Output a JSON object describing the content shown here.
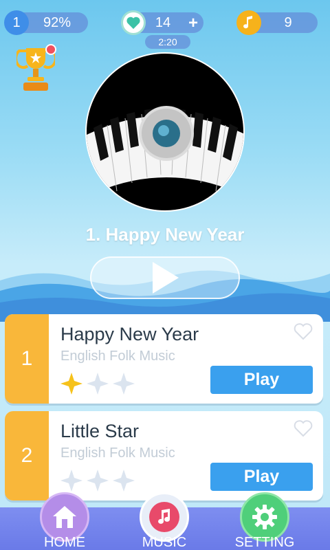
{
  "status": {
    "level": "1",
    "progress": "92%",
    "lives": "14",
    "lives_timer": "2:20",
    "notes": "9"
  },
  "now_playing": {
    "title": "1. Happy New Year"
  },
  "songs": [
    {
      "index": "1",
      "name": "Happy New Year",
      "artist": "English Folk Music",
      "stars_earned": 1,
      "stars_total": 3,
      "play_label": "Play"
    },
    {
      "index": "2",
      "name": "Little Star",
      "artist": "English Folk Music",
      "stars_earned": 0,
      "stars_total": 3,
      "play_label": "Play"
    }
  ],
  "nav": {
    "home": "HOME",
    "music": "MUSIC",
    "setting": "SETTING"
  },
  "icons": {
    "level": "level-badge-icon",
    "lives": "heart-icon",
    "notes": "music-note-icon",
    "trophy": "trophy-icon",
    "play": "play-icon",
    "home": "home-icon",
    "music": "music-icon",
    "setting": "gear-icon"
  },
  "colors": {
    "accent": "#3aa0ee",
    "card_number": "#f9b73a",
    "star_filled": "#f6c21b"
  }
}
